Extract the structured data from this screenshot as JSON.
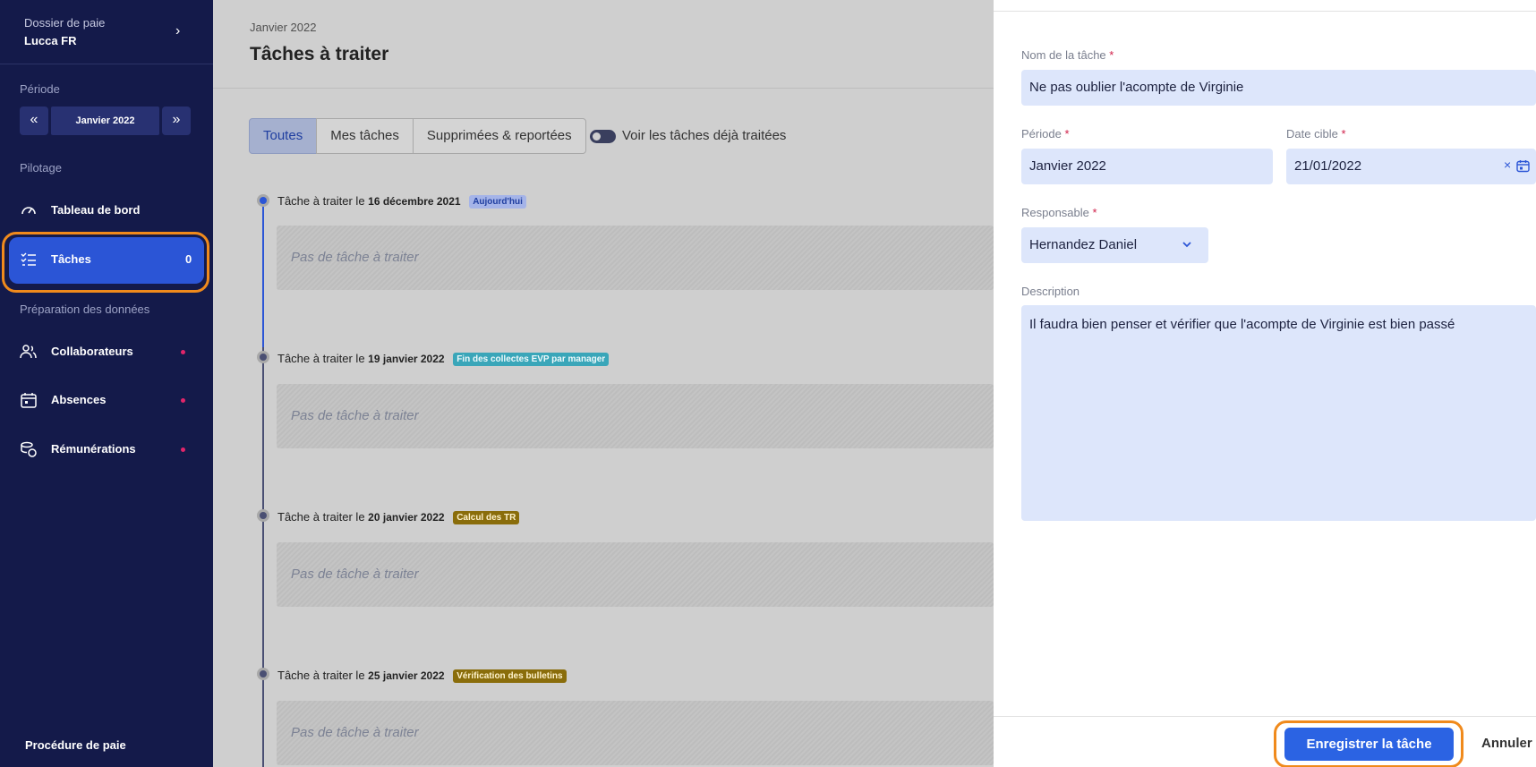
{
  "sidebar": {
    "dossier_label": "Dossier de paie",
    "dossier_name": "Lucca FR",
    "periode_label": "Période",
    "period_value": "Janvier 2022",
    "pilotage_label": "Pilotage",
    "nav_dashboard": "Tableau de bord",
    "nav_tasks": "Tâches",
    "tasks_count": "0",
    "prep_label": "Préparation des données",
    "nav_collab": "Collaborateurs",
    "nav_absences": "Absences",
    "nav_remun": "Rémunérations",
    "procedure": "Procédure de paie"
  },
  "main": {
    "subtitle": "Janvier 2022",
    "title": "Tâches à traiter",
    "tabs": [
      "Toutes",
      "Mes tâches",
      "Supprimées & reportées"
    ],
    "toggle_label": "Voir les tâches déjà traitées",
    "timeline": [
      {
        "prefix": "Tâche à traiter le",
        "date": "16 décembre 2021",
        "badge": "Aujourd'hui",
        "empty": "Pas de tâche à traiter"
      },
      {
        "prefix": "Tâche à traiter le",
        "date": "19 janvier 2022",
        "badge": "Fin des collectes EVP par manager",
        "empty": "Pas de tâche à traiter"
      },
      {
        "prefix": "Tâche à traiter le",
        "date": "20 janvier 2022",
        "badge": "Calcul des TR",
        "empty": "Pas de tâche à traiter"
      },
      {
        "prefix": "Tâche à traiter le",
        "date": "25 janvier 2022",
        "badge": "Vérification des bulletins",
        "empty": "Pas de tâche à traiter"
      }
    ]
  },
  "form": {
    "name_label": "Nom de la tâche",
    "name_value": "Ne pas oublier l'acompte de Virginie",
    "period_label": "Période",
    "period_value": "Janvier 2022",
    "date_label": "Date cible",
    "date_value": "21/01/2022",
    "owner_label": "Responsable",
    "owner_value": "Hernandez Daniel",
    "desc_label": "Description",
    "desc_value": "Il faudra bien penser et vérifier que l'acompte de Virginie est bien passé",
    "required_mark": "*",
    "save_label": "Enregistrer la tâche",
    "cancel_label": "Annuler"
  },
  "colors": {
    "sidebar_bg": "#141a4a",
    "accent": "#2b55d6",
    "highlight": "#f08a1c",
    "badge_today": "#a5b4e8",
    "badge_evp": "#3aa6b9",
    "badge_tr": "#8a6d0b",
    "badge_bulletins": "#8a6d0b"
  },
  "icons": [
    "chevron-right-icon",
    "double-chevron-left-icon",
    "double-chevron-right-icon",
    "gauge-icon",
    "task-list-icon",
    "users-icon",
    "calendar-icon",
    "coins-icon",
    "close-icon",
    "chevron-down-icon",
    "check-icon"
  ]
}
